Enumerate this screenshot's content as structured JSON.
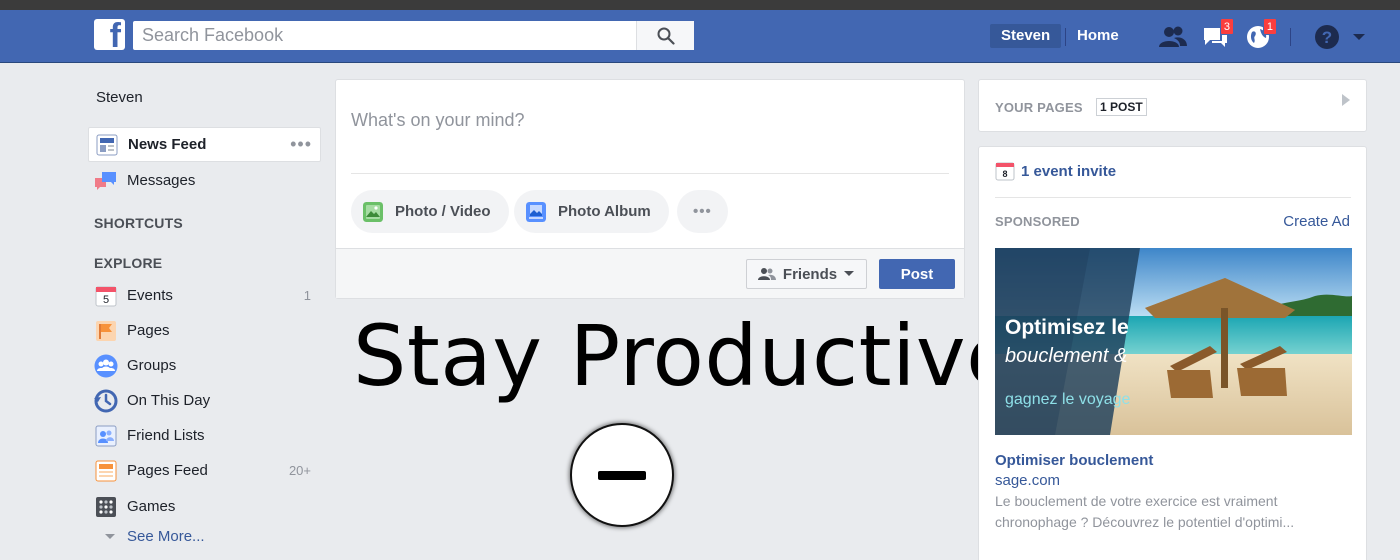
{
  "header": {
    "logo": "f",
    "search_placeholder": "Search Facebook",
    "profile_label": "Steven",
    "home_label": "Home",
    "messages_badge": "3",
    "notifications_badge": "1",
    "brand_color": "#4267b2"
  },
  "left_nav": {
    "user_name": "Steven",
    "news_feed": "News Feed",
    "news_feed_more": "•••",
    "messages": "Messages",
    "shortcuts_heading": "SHORTCUTS",
    "explore_heading": "EXPLORE",
    "events": {
      "label": "Events",
      "count": "1",
      "icon_day": "5"
    },
    "pages": "Pages",
    "groups": "Groups",
    "on_this_day": "On This Day",
    "friend_lists": "Friend Lists",
    "pages_feed": {
      "label": "Pages Feed",
      "count": "20+"
    },
    "games": "Games",
    "see_more": "See More..."
  },
  "composer": {
    "placeholder": "What's on your mind?",
    "photo_video": "Photo / Video",
    "photo_album": "Photo Album",
    "more": "•••",
    "audience": "Friends",
    "post": "Post"
  },
  "overlay": {
    "title": "Stay Productive"
  },
  "right": {
    "your_pages": "YOUR PAGES",
    "post_badge": "1 POST",
    "event_icon_day": "8",
    "event_invite": "1 event invite",
    "sponsored": "SPONSORED",
    "create_ad": "Create Ad",
    "ad": {
      "headline_1": "Optimisez le",
      "headline_2": "bouclement &",
      "headline_3": "gagnez le voyage",
      "title": "Optimiser bouclement",
      "url": "sage.com",
      "description": "Le bouclement de votre exercice est vraiment chronophage ? Découvrez le potentiel d'optimi..."
    }
  }
}
